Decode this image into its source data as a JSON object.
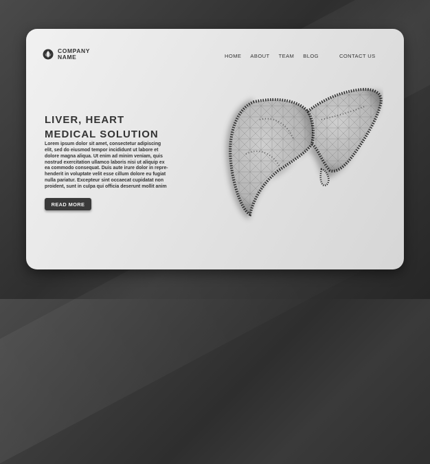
{
  "logo": {
    "icon": "logo-icon",
    "line1": "COMPANY",
    "line2": "NAME"
  },
  "nav": {
    "items": [
      "HOME",
      "ABOUT",
      "TEAM",
      "BLOG",
      "CONTACT US"
    ]
  },
  "hero": {
    "headline_line1": "LIVER, HEART",
    "headline_line2": "MEDICAL SOLUTION",
    "body_lines": [
      "Lorem ipsum dolor sit amet, consectetur adipiscing",
      "elit, sed do eiusmod tempor incididunt ut labore et",
      "dolore magna aliqua. Ut enim ad minim veniam, quis",
      "nostrud exercitation ullamco laboris nisi ut aliquip ex",
      "ea commodo consequat. Duis aute irure dolor in repre-",
      "henderit in voluptate velit esse cillum dolore eu fugiat",
      "nulla pariatur. Excepteur sint occaecat cupidatat non",
      "proident, sunt in culpa qui officia deserunt mollit anim"
    ],
    "button_label": "READ MORE"
  },
  "illustration": {
    "icon": "liver-illustration"
  },
  "colors": {
    "card": "#e6e6e6",
    "background": "#333333",
    "button": "#3a3a3a",
    "text": "#333333"
  }
}
